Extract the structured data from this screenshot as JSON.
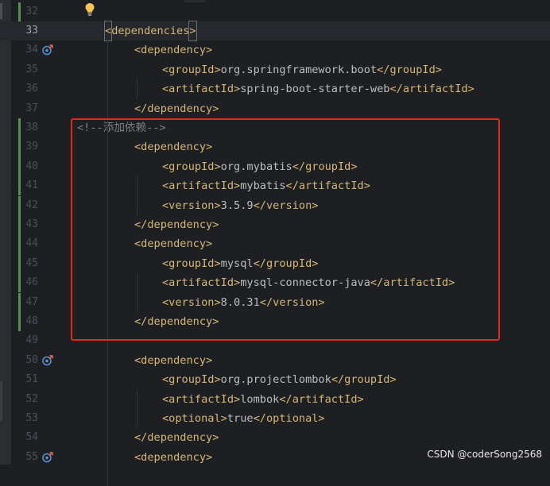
{
  "editor": {
    "lines": [
      {
        "num": "32",
        "current": false,
        "segments": []
      },
      {
        "num": "33",
        "current": true,
        "segments": [
          {
            "t": "<dependencies>",
            "c": "tag"
          }
        ]
      },
      {
        "num": "34",
        "current": false,
        "segments": [
          {
            "t": "<dependency>",
            "c": "tag"
          }
        ]
      },
      {
        "num": "35",
        "current": false,
        "segments": [
          {
            "t": "<groupId>",
            "c": "tag"
          },
          {
            "t": "org.springframework.boot",
            "c": "text"
          },
          {
            "t": "</groupId>",
            "c": "tag"
          }
        ]
      },
      {
        "num": "36",
        "current": false,
        "segments": [
          {
            "t": "<artifactId>",
            "c": "tag"
          },
          {
            "t": "spring-boot-starter-web",
            "c": "text"
          },
          {
            "t": "</artifactId>",
            "c": "tag"
          }
        ]
      },
      {
        "num": "37",
        "current": false,
        "segments": [
          {
            "t": "</dependency>",
            "c": "tag"
          }
        ]
      },
      {
        "num": "38",
        "current": false,
        "segments": [
          {
            "t": "<!--添加依赖-->",
            "c": "comment"
          }
        ]
      },
      {
        "num": "39",
        "current": false,
        "segments": [
          {
            "t": "<dependency>",
            "c": "tag"
          }
        ]
      },
      {
        "num": "40",
        "current": false,
        "segments": [
          {
            "t": "<groupId>",
            "c": "tag"
          },
          {
            "t": "org.mybatis",
            "c": "text"
          },
          {
            "t": "</groupId>",
            "c": "tag"
          }
        ]
      },
      {
        "num": "41",
        "current": false,
        "segments": [
          {
            "t": "<artifactId>",
            "c": "tag"
          },
          {
            "t": "mybatis",
            "c": "text"
          },
          {
            "t": "</artifactId>",
            "c": "tag"
          }
        ]
      },
      {
        "num": "42",
        "current": false,
        "segments": [
          {
            "t": "<version>",
            "c": "tag"
          },
          {
            "t": "3.5.9",
            "c": "text"
          },
          {
            "t": "</version>",
            "c": "tag"
          }
        ]
      },
      {
        "num": "43",
        "current": false,
        "segments": [
          {
            "t": "</dependency>",
            "c": "tag"
          }
        ]
      },
      {
        "num": "44",
        "current": false,
        "segments": [
          {
            "t": "<dependency>",
            "c": "tag"
          }
        ]
      },
      {
        "num": "45",
        "current": false,
        "segments": [
          {
            "t": "<groupId>",
            "c": "tag"
          },
          {
            "t": "mysql",
            "c": "text"
          },
          {
            "t": "</groupId>",
            "c": "tag"
          }
        ]
      },
      {
        "num": "46",
        "current": false,
        "segments": [
          {
            "t": "<artifactId>",
            "c": "tag"
          },
          {
            "t": "mysql-connector-java",
            "c": "text"
          },
          {
            "t": "</artifactId>",
            "c": "tag"
          }
        ]
      },
      {
        "num": "47",
        "current": false,
        "segments": [
          {
            "t": "<version>",
            "c": "tag"
          },
          {
            "t": "8.0.31",
            "c": "text"
          },
          {
            "t": "</version>",
            "c": "tag"
          }
        ]
      },
      {
        "num": "48",
        "current": false,
        "segments": [
          {
            "t": "</dependency>",
            "c": "tag"
          }
        ]
      },
      {
        "num": "49",
        "current": false,
        "segments": []
      },
      {
        "num": "50",
        "current": false,
        "segments": [
          {
            "t": "<dependency>",
            "c": "tag"
          }
        ]
      },
      {
        "num": "51",
        "current": false,
        "segments": [
          {
            "t": "<groupId>",
            "c": "tag"
          },
          {
            "t": "org.projectlombok",
            "c": "text"
          },
          {
            "t": "</groupId>",
            "c": "tag"
          }
        ]
      },
      {
        "num": "52",
        "current": false,
        "segments": [
          {
            "t": "<artifactId>",
            "c": "tag"
          },
          {
            "t": "lombok",
            "c": "text"
          },
          {
            "t": "</artifactId>",
            "c": "tag"
          }
        ]
      },
      {
        "num": "53",
        "current": false,
        "segments": [
          {
            "t": "<optional>",
            "c": "tag"
          },
          {
            "t": "true",
            "c": "text"
          },
          {
            "t": "</optional>",
            "c": "tag"
          }
        ]
      },
      {
        "num": "54",
        "current": false,
        "segments": [
          {
            "t": "</dependency>",
            "c": "tag"
          }
        ]
      },
      {
        "num": "55",
        "current": false,
        "segments": [
          {
            "t": "<dependency>",
            "c": "tag"
          }
        ]
      }
    ],
    "gutter_icons": [
      {
        "line": "34",
        "icon": "navigate-to-dependency-icon"
      },
      {
        "line": "50",
        "icon": "navigate-to-dependency-icon"
      },
      {
        "line": "55",
        "icon": "navigate-to-dependency-icon"
      }
    ],
    "intention_icon": "lightbulb-icon"
  },
  "colors": {
    "background": "#1e1f22",
    "tag": "#d5b778",
    "text": "#bcbec4",
    "comment": "#7a7e85",
    "vcs_added": "#549159",
    "highlight_box": "#e1281c"
  },
  "watermark": "CSDN @coderSong2568"
}
